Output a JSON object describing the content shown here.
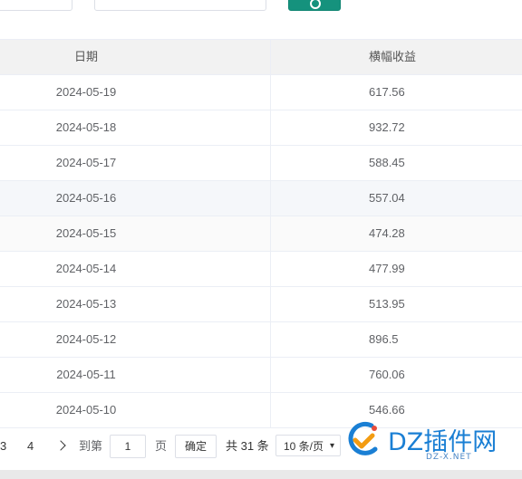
{
  "table": {
    "headers": [
      "日期",
      "横幅收益"
    ],
    "rows": [
      {
        "date": "2024-05-19",
        "income": "617.56"
      },
      {
        "date": "2024-05-18",
        "income": "932.72"
      },
      {
        "date": "2024-05-17",
        "income": "588.45"
      },
      {
        "date": "2024-05-16",
        "income": "557.04"
      },
      {
        "date": "2024-05-15",
        "income": "474.28"
      },
      {
        "date": "2024-05-14",
        "income": "477.99"
      },
      {
        "date": "2024-05-13",
        "income": "513.95"
      },
      {
        "date": "2024-05-12",
        "income": "896.5"
      },
      {
        "date": "2024-05-11",
        "income": "760.06"
      },
      {
        "date": "2024-05-10",
        "income": "546.66"
      }
    ]
  },
  "pagination": {
    "page_3": "3",
    "page_4": "4",
    "goto_label": "到第",
    "goto_value": "1",
    "page_unit": "页",
    "confirm_label": "确定",
    "total_text": "共 31 条",
    "page_size_selected": "10 条/页"
  },
  "watermark": {
    "brand": "DZ插件网",
    "url": "DZ-X.NET"
  },
  "colors": {
    "accent": "#15927d",
    "highlight_row": "#f5f7fa",
    "header_bg": "#f2f2f2"
  }
}
